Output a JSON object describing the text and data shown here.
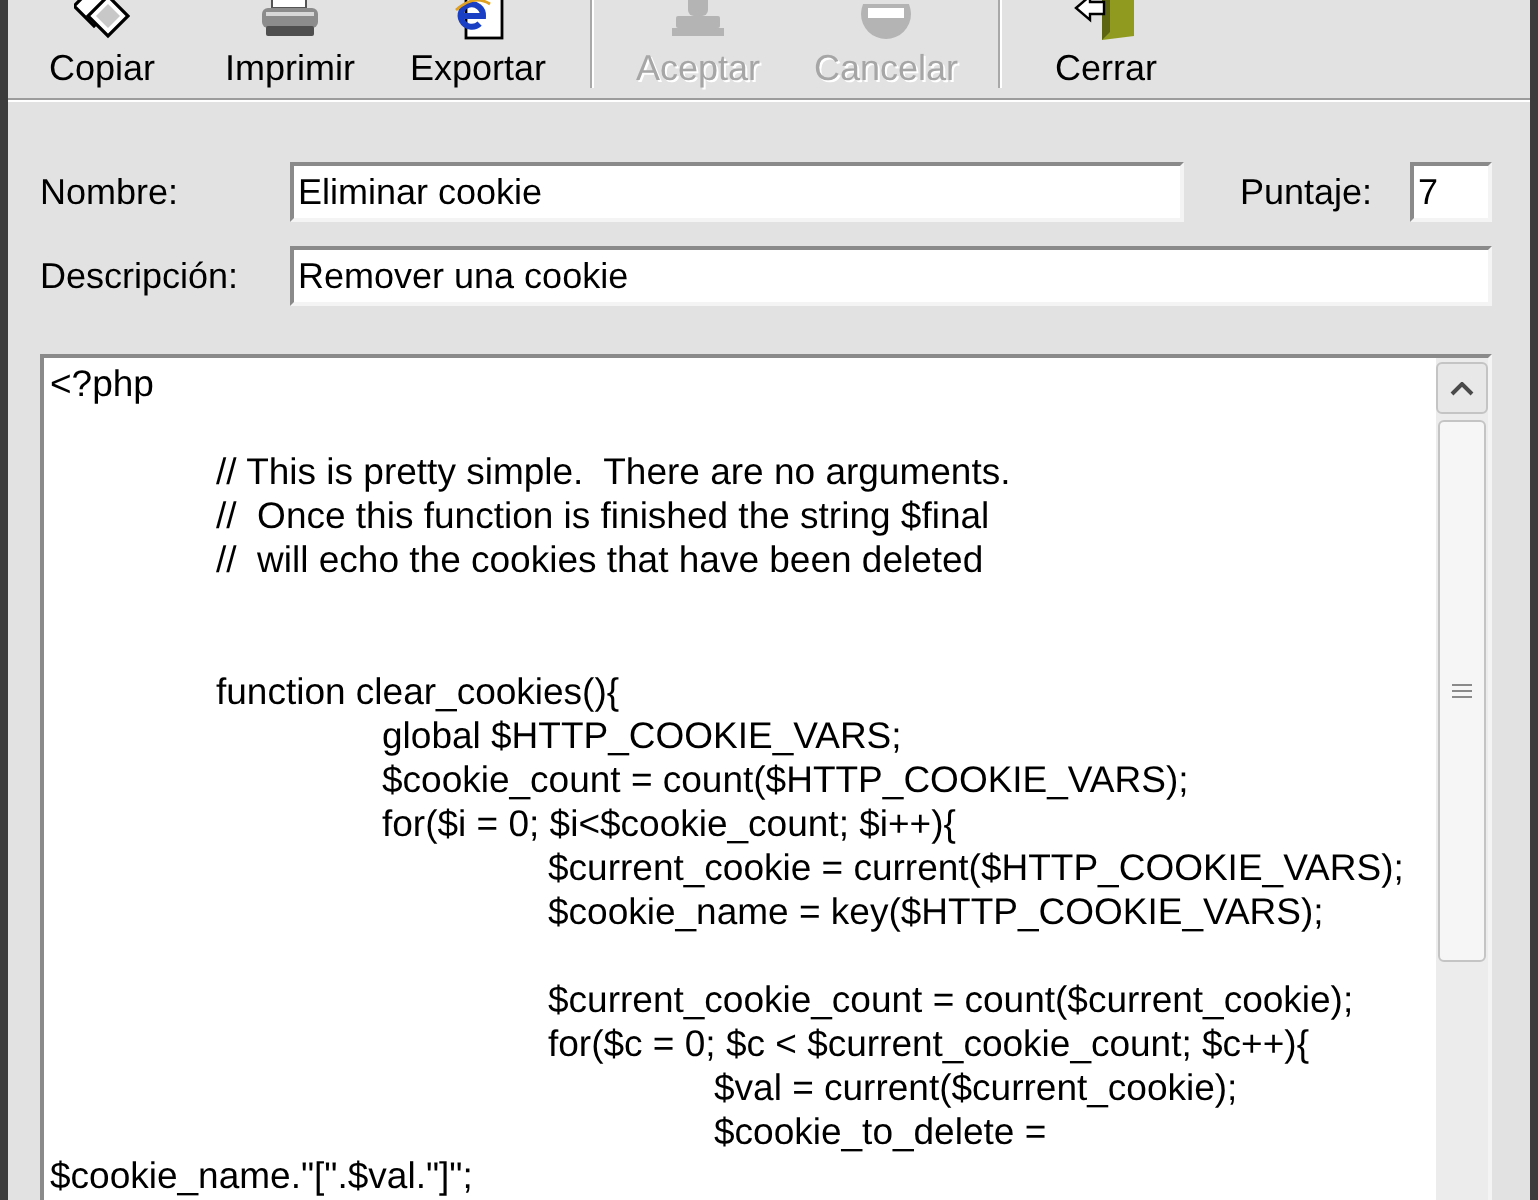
{
  "toolbar": {
    "groups": [
      [
        {
          "label": "Copiar",
          "disabled": false
        },
        {
          "label": "Imprimir",
          "disabled": false
        },
        {
          "label": "Exportar",
          "disabled": false
        }
      ],
      [
        {
          "label": "Aceptar",
          "disabled": true
        },
        {
          "label": "Cancelar",
          "disabled": true
        }
      ],
      [
        {
          "label": "Cerrar",
          "disabled": false
        }
      ]
    ]
  },
  "form": {
    "name": {
      "label": "Nombre:",
      "value": "Eliminar cookie"
    },
    "score": {
      "label": "Puntaje:",
      "value": "7"
    },
    "description": {
      "label": "Descripción:",
      "value": "Remover una cookie"
    }
  },
  "code": "<?php\n\n\t// This is pretty simple.  There are no arguments.\n\t//  Once this function is finished the string $final\n\t//  will echo the cookies that have been deleted\n\n\n\tfunction clear_cookies(){\n\t\tglobal $HTTP_COOKIE_VARS;\n\t\t$cookie_count = count($HTTP_COOKIE_VARS);\n\t\tfor($i = 0; $i<$cookie_count; $i++){\n\t\t\t$current_cookie = current($HTTP_COOKIE_VARS);\n\t\t\t$cookie_name = key($HTTP_COOKIE_VARS);\n\n\t\t\t$current_cookie_count = count($current_cookie);\n\t\t\tfor($c = 0; $c < $current_cookie_count; $c++){\n\t\t\t\t$val = current($current_cookie);\n\t\t\t\t$cookie_to_delete =\n$cookie_name.\"[\".$val.\"]\";"
}
